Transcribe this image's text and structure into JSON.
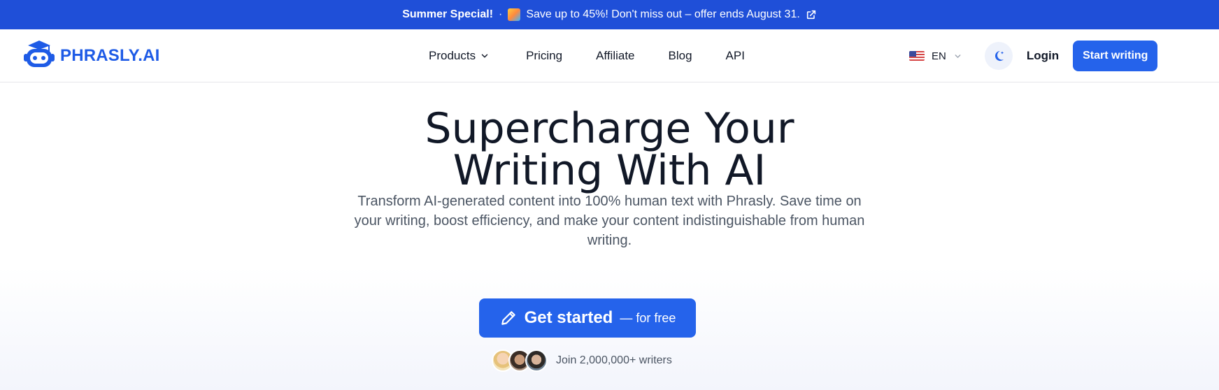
{
  "promo": {
    "title": "Summer Special!",
    "separator": "·",
    "message": "Save up to 45%! Don't miss out – offer ends August 31."
  },
  "nav": {
    "logo_text": "PHRASLY.AI",
    "menu": {
      "products": "Products",
      "pricing": "Pricing",
      "affiliate": "Affiliate",
      "blog": "Blog",
      "api": "API"
    },
    "language": "EN",
    "login": "Login",
    "start_writing": "Start writing"
  },
  "hero": {
    "title_line1": "Supercharge Your",
    "title_line2": "Writing With AI",
    "subtitle": "Transform AI-generated content into 100% human text with Phrasly. Save time on your writing, boost efficiency, and make your content indistinguishable from human writing.",
    "cta_main": "Get started",
    "cta_suffix": "— for free",
    "social_proof": "Join 2,000,000+ writers"
  },
  "colors": {
    "brand": "#2563eb",
    "banner": "#1f4fd8",
    "text": "#111827",
    "muted": "#4b5563"
  },
  "icons": {
    "promo_emoji": "sunset-emoji-icon",
    "promo_link": "external-link-icon",
    "logo": "robot-graduate-icon",
    "products_caret": "chevron-down-icon",
    "language_flag": "us-flag-icon",
    "language_caret": "chevron-down-icon",
    "theme_toggle": "moon-star-icon",
    "cta": "pencil-icon"
  }
}
